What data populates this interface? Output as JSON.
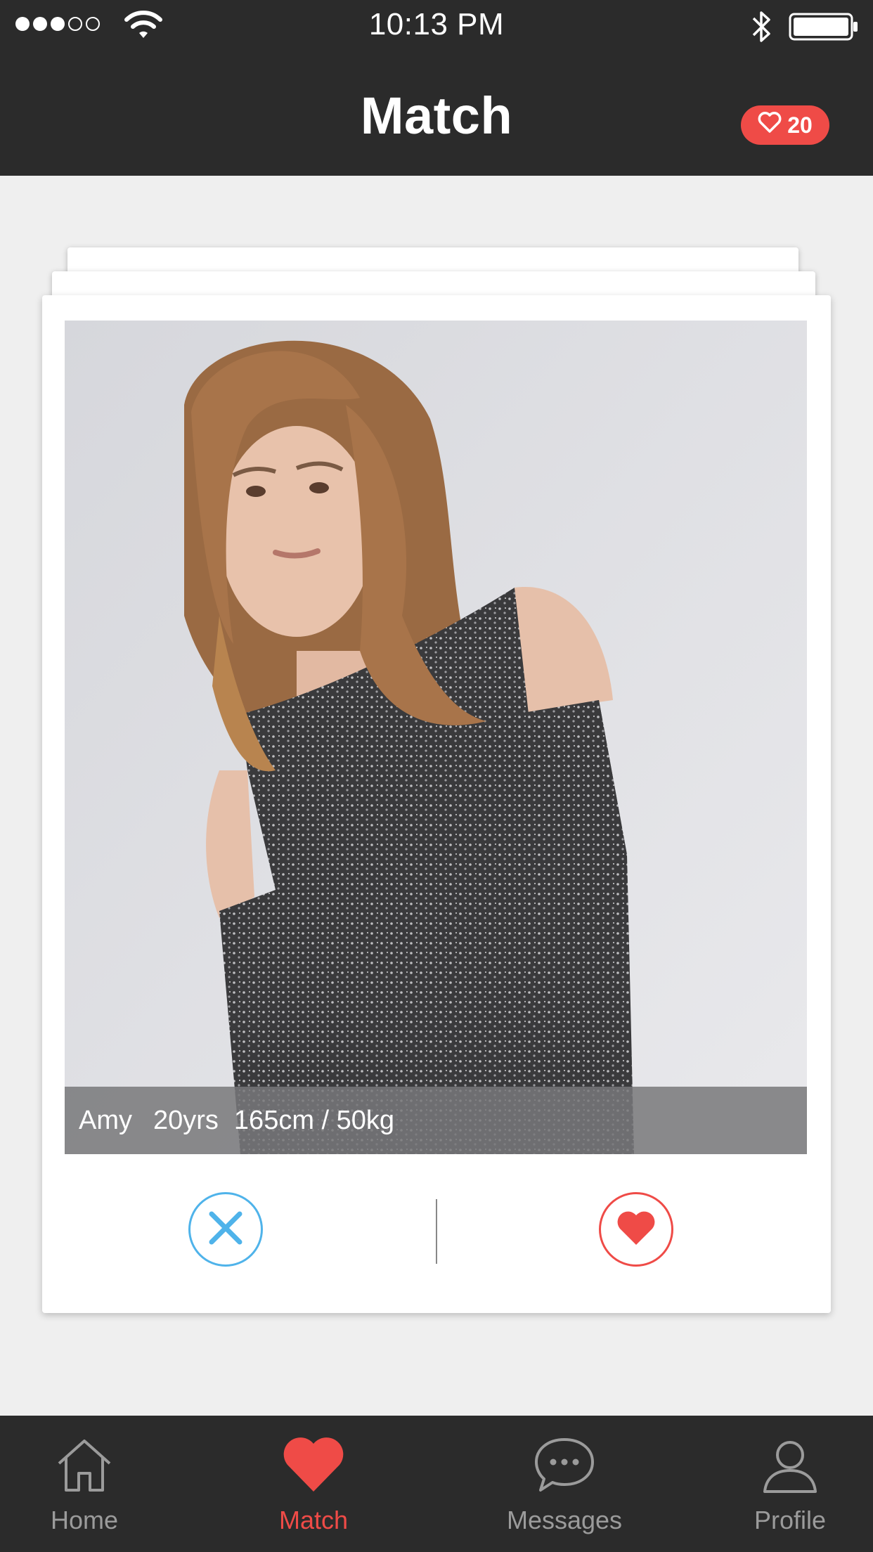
{
  "status_bar": {
    "time": "10:13 PM",
    "signal_bars_filled": 3,
    "signal_bars_total": 5
  },
  "header": {
    "title": "Match",
    "likes_count": "20"
  },
  "profile": {
    "name": "Amy",
    "age": "20yrs",
    "measurements": "165cm / 50kg"
  },
  "actions": {
    "dislike_icon": "close-icon",
    "like_icon": "heart-icon"
  },
  "tabs": [
    {
      "label": "Home",
      "icon": "home-icon",
      "active": false
    },
    {
      "label": "Match",
      "icon": "heart-icon",
      "active": true
    },
    {
      "label": "Messages",
      "icon": "chat-bubble-icon",
      "active": false
    },
    {
      "label": "Profile",
      "icon": "person-icon",
      "active": false
    }
  ],
  "colors": {
    "accent": "#ef4b47",
    "dislike": "#4fb3ea",
    "header_bg": "#2b2b2b",
    "page_bg": "#efefef"
  }
}
